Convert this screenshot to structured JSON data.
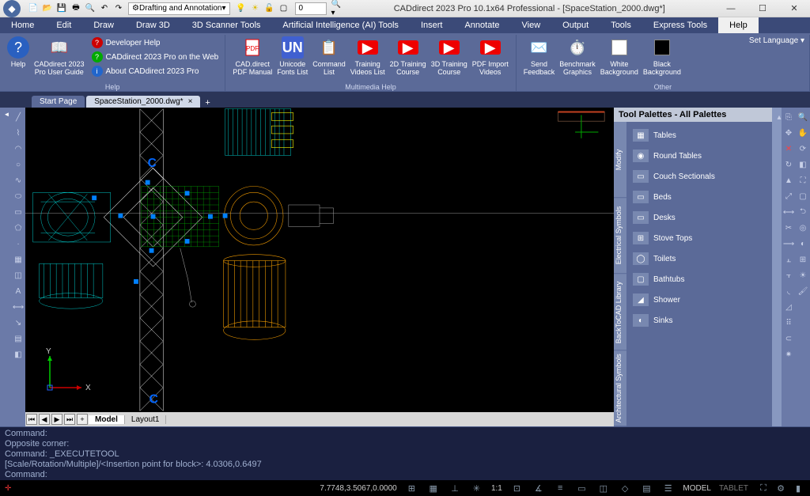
{
  "app": {
    "title": "CADdirect 2023 Pro 10.1x64 Professional  - [SpaceStation_2000.dwg*]",
    "workspace": "Drafting and Annotation",
    "layer": "0"
  },
  "menu": [
    "Home",
    "Edit",
    "Draw",
    "Draw 3D",
    "3D Scanner Tools",
    "Artificial Intelligence (AI) Tools",
    "Insert",
    "Annotate",
    "View",
    "Output",
    "Tools",
    "Express Tools",
    "Help"
  ],
  "menu_active": "Help",
  "ribbon": {
    "help_btn": "Help",
    "user_guide": "CADdirect 2023\nPro User Guide",
    "dev_help": "Developer Help",
    "on_web": "CADdirect 2023 Pro on the Web",
    "about": "About CADdirect 2023 Pro",
    "pdf_manual": "CAD.direct\nPDF Manual",
    "fonts_list": "Unicode\nFonts List",
    "cmd_list": "Command\nList",
    "videos_list": "Training\nVideos List",
    "course2d": "2D Training\nCourse",
    "course3d": "3D Training\nCourse",
    "pdf_import": "PDF Import\nVideos",
    "send_fb": "Send\nFeedback",
    "bench": "Benchmark\nGraphics",
    "white_bg": "White\nBackground",
    "black_bg": "Black\nBackground",
    "set_lang": "Set Language",
    "group_help": "Help",
    "group_mm": "Multimedia Help",
    "group_other": "Other"
  },
  "tabs": {
    "start": "Start Page",
    "file": "SpaceStation_2000.dwg*"
  },
  "layout": {
    "model": "Model",
    "layout1": "Layout1"
  },
  "palette": {
    "title": "Tool Palettes - All Palettes",
    "sidetabs": [
      "Modify",
      "Electrical Symbols",
      "BackToCAD Library",
      "Architectural Symbols"
    ],
    "items": [
      "Tables",
      "Round Tables",
      "Couch Sectionals",
      "Beds",
      "Desks",
      "Stove Tops",
      "Toilets",
      "Bathtubs",
      "Shower",
      "Sinks"
    ]
  },
  "cmd": {
    "l1": "Command:",
    "l2": "Opposite corner:",
    "l3": "Command: _EXECUTETOOL",
    "l4": "[Scale/Rotation/Multiple]/<Insertion point for block>: 4.0306,0.6497",
    "l5": "Command:"
  },
  "status": {
    "coords": "7.7748,3.5067,0.0000",
    "scale": "1:1",
    "model": "MODEL",
    "tablet": "TABLET"
  },
  "ucs": {
    "x": "X",
    "y": "Y"
  }
}
